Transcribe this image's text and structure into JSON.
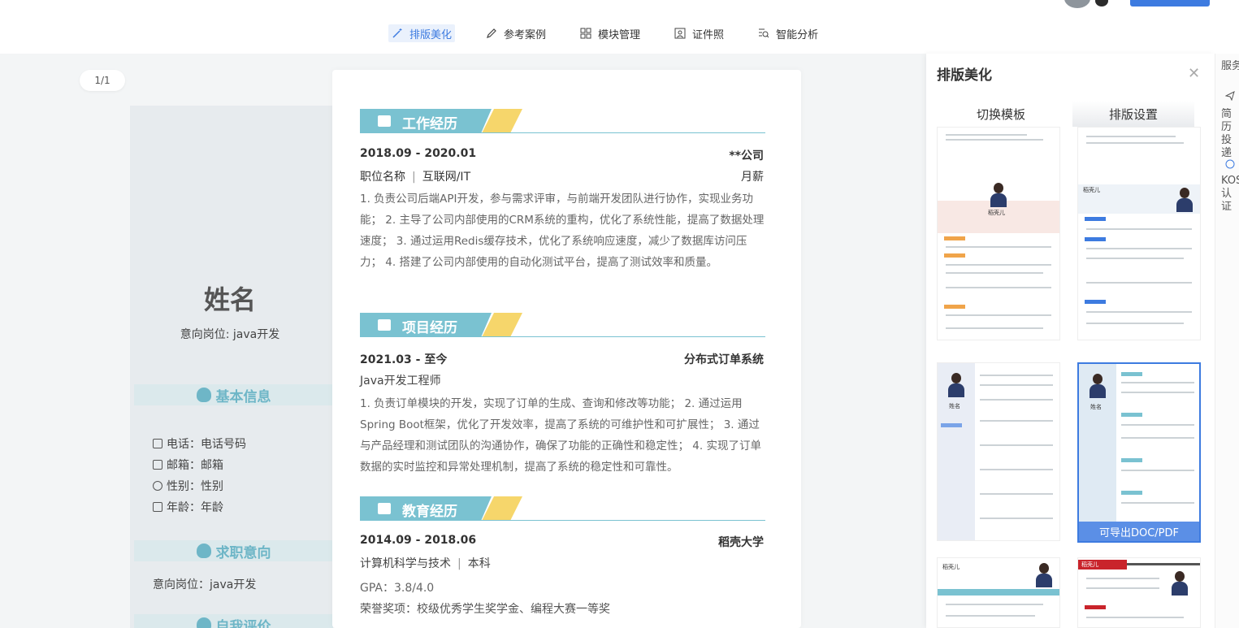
{
  "toolbar": {
    "items": [
      {
        "label": "排版美化",
        "icon": "magic-wand-icon",
        "active": true
      },
      {
        "label": "参考案例",
        "icon": "pen-icon"
      },
      {
        "label": "模块管理",
        "icon": "grid-icon"
      },
      {
        "label": "证件照",
        "icon": "id-photo-icon"
      },
      {
        "label": "智能分析",
        "icon": "analysis-icon"
      }
    ]
  },
  "page_indicator": "1/1",
  "resume": {
    "name": "姓名",
    "intent": "意向岗位: java开发",
    "left_sections": {
      "basic": "基本信息",
      "job": "求职意向",
      "self": "自我评价"
    },
    "basic_info": [
      {
        "label": "电话：电话号码",
        "icon": "phone-icon"
      },
      {
        "label": "邮箱：邮箱",
        "icon": "mail-icon"
      },
      {
        "label": "性别：性别",
        "icon": "gender-icon"
      },
      {
        "label": "年龄：年龄",
        "icon": "age-icon"
      }
    ],
    "job_intent": "意向岗位：java开发",
    "work": {
      "title": "工作经历",
      "period": "2018.09 - 2020.01",
      "company": "**公司",
      "position": "职位名称",
      "industry": "互联网/IT",
      "salary": "月薪",
      "desc": "1. 负责公司后端API开发，参与需求评审，与前端开发团队进行协作，实现业务功能；  2. 主导了公司内部使用的CRM系统的重构，优化了系统性能，提高了数据处理速度；  3. 通过运用Redis缓存技术，优化了系统响应速度，减少了数据库访问压力；  4. 搭建了公司内部使用的自动化测试平台，提高了测试效率和质量。"
    },
    "project": {
      "title": "项目经历",
      "period": "2021.03 - 至今",
      "name": "分布式订单系统",
      "role": "Java开发工程师",
      "desc": "1. 负责订单模块的开发，实现了订单的生成、查询和修改等功能；  2. 通过运用Spring Boot框架，优化了开发效率，提高了系统的可维护性和可扩展性；  3. 通过与产品经理和测试团队的沟通协作，确保了功能的正确性和稳定性；  4. 实现了订单数据的实时监控和异常处理机制，提高了系统的稳定性和可靠性。"
    },
    "education": {
      "title": "教育经历",
      "period": "2014.09 - 2018.06",
      "school": "稻壳大学",
      "major": "计算机科学与技术",
      "degree": "本科",
      "gpa": "GPA：3.8/4.0",
      "awards": "荣誉奖项：校级优秀学生奖学金、编程大赛一等奖"
    }
  },
  "panel": {
    "title": "排版美化",
    "tabs": [
      "切换模板",
      "排版设置"
    ],
    "thumb_names": [
      "稻壳儿",
      "稻壳儿",
      "姓名",
      "姓名",
      "稻壳儿",
      "稻壳儿"
    ],
    "export_label": "可导出DOC/PDF",
    "accent": "#3d7be0"
  },
  "sidebar": {
    "top": "服务",
    "item1": "简历投递",
    "item2": "KOS认证"
  },
  "colors": {
    "section": "#7ac2d1",
    "accent_yellow": "#f6d66b",
    "brand": "#3d7be0"
  }
}
